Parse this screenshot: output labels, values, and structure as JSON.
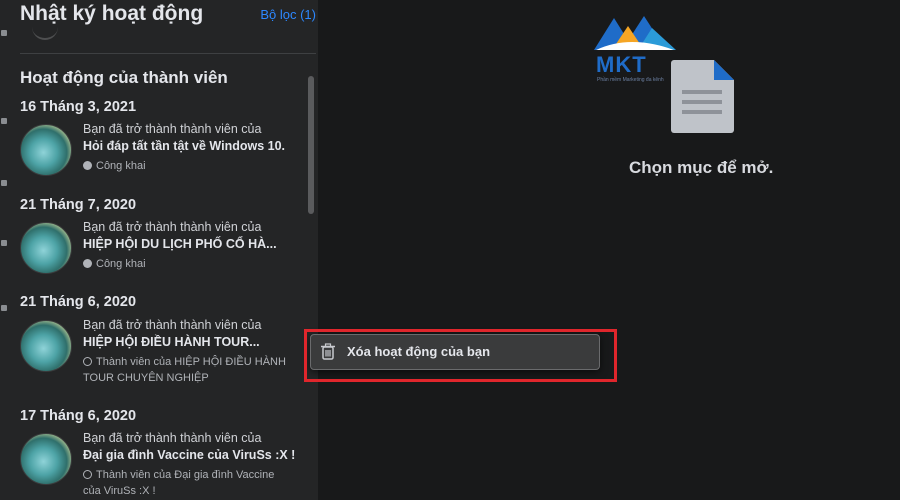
{
  "panel": {
    "title": "Nhật ký hoạt động",
    "filter_label": "Bộ lọc (1)",
    "section_title": "Hoạt động của thành viên"
  },
  "groups": [
    {
      "date": "16 Tháng 3, 2021",
      "line1": "Bạn đã trở thành thành viên của",
      "line2": "Hỏi đáp tất tần tật về Windows 10.",
      "meta": "Công khai",
      "meta_icon": "globe-icon"
    },
    {
      "date": "21 Tháng 7, 2020",
      "line1": "Bạn đã trở thành thành viên của",
      "line2": "HIỆP HỘI DU LỊCH PHỐ CỔ HÀ...",
      "meta": "Công khai",
      "meta_icon": "globe-icon"
    },
    {
      "date": "21 Tháng 6, 2020",
      "line1": "Bạn đã trở thành thành viên của",
      "line2": "HIỆP HỘI ĐIỀU HÀNH TOUR...",
      "meta": "Thành viên của HIỆP HỘI ĐIỀU HÀNH TOUR CHUYÊN NGHIỆP",
      "meta_icon": "member-icon"
    },
    {
      "date": "17 Tháng 6, 2020",
      "line1": "Bạn đã trở thành thành viên của",
      "line2": "Đại gia đình Vaccine của ViruSs :X !",
      "meta": "Thành viên của Đại gia đình Vaccine của ViruSs :X !",
      "meta_icon": "member-icon"
    }
  ],
  "context_menu": {
    "item_label": "Xóa hoạt động của bạn",
    "item_icon": "trash-icon"
  },
  "main": {
    "empty_state_text": "Chọn mục để mở.",
    "empty_state_icon": "document-icon"
  },
  "logo": {
    "text": "MKT",
    "tagline": "Phần mềm Marketing đa kênh"
  },
  "colors": {
    "background": "#18191a",
    "panel": "#242526",
    "link": "#2d88ff",
    "highlight": "#e0262c",
    "logo_blue": "#1f6cc8",
    "logo_orange": "#f5a524"
  }
}
